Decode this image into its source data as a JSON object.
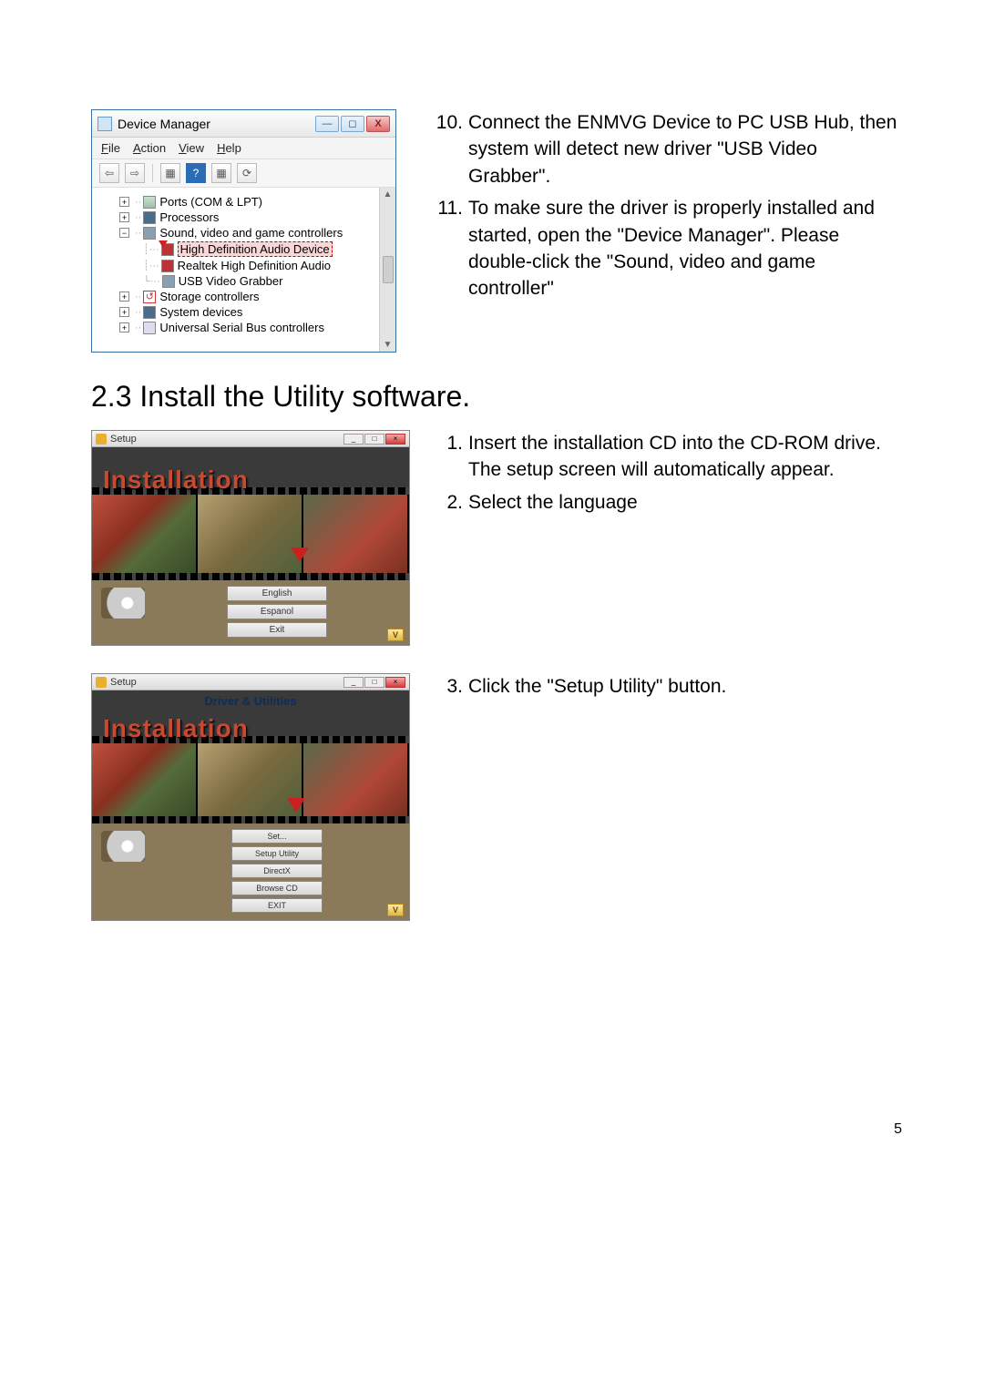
{
  "steps_top": [
    {
      "num": "10.",
      "text": "Connect the ENMVG Device to PC USB Hub, then system will detect new driver \"USB Video Grabber\"."
    },
    {
      "num": "11.",
      "text": "To make sure the driver is properly installed and started, open the \"Device Manager\". Please double-click the \"Sound, video and game controller\""
    }
  ],
  "section_heading": "2.3 Install the Utility software.",
  "steps_mid": [
    {
      "num": "1.",
      "text": "Insert the installation CD into the CD-ROM drive. The setup screen will automatically appear."
    },
    {
      "num": "2.",
      "text": "Select the language"
    }
  ],
  "steps_bot": [
    {
      "num": "3.",
      "text": "Click the \"Setup Utility\" button."
    }
  ],
  "page_number": "5",
  "device_manager": {
    "title": "Device Manager",
    "menu": {
      "file": "File",
      "action": "Action",
      "view": "View",
      "help": "Help"
    },
    "tree": {
      "ports": "Ports (COM & LPT)",
      "processors": "Processors",
      "sound": "Sound, video and game controllers",
      "hd_audio": "High Definition Audio Device",
      "realtek": "Realtek High Definition Audio",
      "usb_grabber": "USB Video Grabber",
      "storage": "Storage controllers",
      "system": "System devices",
      "usb_ctrl": "Universal Serial Bus controllers"
    }
  },
  "setup1": {
    "title": "Setup",
    "hero": "Installation",
    "buttons": {
      "english": "English",
      "espanol": "Espanol",
      "exit": "Exit"
    },
    "badge": "V"
  },
  "setup2": {
    "title": "Setup",
    "hero": "Installation",
    "sub": "Driver & Utilities",
    "buttons": {
      "setup_driver": "Set...",
      "setup_utility": "Setup Utility",
      "directx": "DirectX",
      "browse": "Browse CD",
      "exit": "EXIT"
    },
    "badge": "V"
  }
}
